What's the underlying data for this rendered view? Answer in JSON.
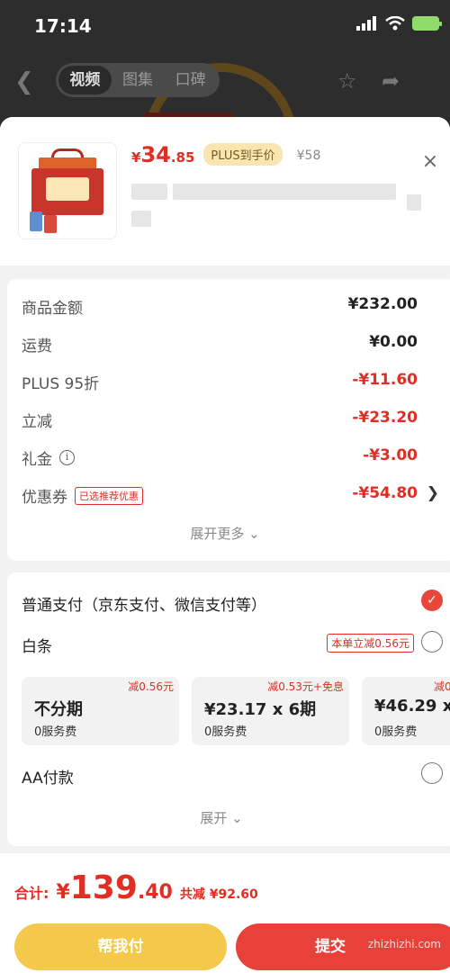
{
  "status": {
    "time": "17:14"
  },
  "nav": {
    "tabs": [
      "视频",
      "图集",
      "口碑"
    ]
  },
  "product": {
    "price_currency": "¥",
    "price_int": "34",
    "price_dec": ".85",
    "plus_badge": "PLUS到手价",
    "original_price": "¥58",
    "close": "×"
  },
  "costs": [
    {
      "label": "商品金额",
      "value": "¥232.00",
      "color": "#222222"
    },
    {
      "label": "运费",
      "value": "¥0.00",
      "color": "#222222"
    },
    {
      "label": "PLUS 95折",
      "value": "-¥11.60",
      "color": "#e02e24"
    },
    {
      "label": "立减",
      "value": "-¥23.20",
      "color": "#e02e24"
    },
    {
      "label": "礼金",
      "value": "-¥3.00",
      "color": "#e02e24"
    },
    {
      "label": "优惠券",
      "value": "-¥54.80",
      "color": "#e02e24",
      "tag": "已选推荐优惠"
    }
  ],
  "cost_expand": "展开更多",
  "payment": {
    "normal_label": "普通支付（京东支付、微信支付等）",
    "baitiao_label": "白条",
    "baitiao_promo": "本单立减0.56元",
    "installments": [
      {
        "tag": "减0.56元",
        "title": "不分期",
        "fee": "0服务费"
      },
      {
        "tag": "减0.53元+免息",
        "title": "¥23.17 x 6期",
        "fee": "0服务费"
      },
      {
        "tag": "减0.",
        "title": "¥46.29 x",
        "fee": "0服务费"
      }
    ],
    "aa_label": "AA付款",
    "expand": "展开"
  },
  "bottom": {
    "total_label": "合计:",
    "total_currency": "¥",
    "total_int": "139",
    "total_dec": ".40",
    "saved": "共减 ¥92.60",
    "help_pay": "帮我付",
    "submit": "提交",
    "watermark": "zhizhizhi.com"
  },
  "colors": {
    "accent_red": "#e02e24",
    "yellow": "#f4c84a"
  }
}
